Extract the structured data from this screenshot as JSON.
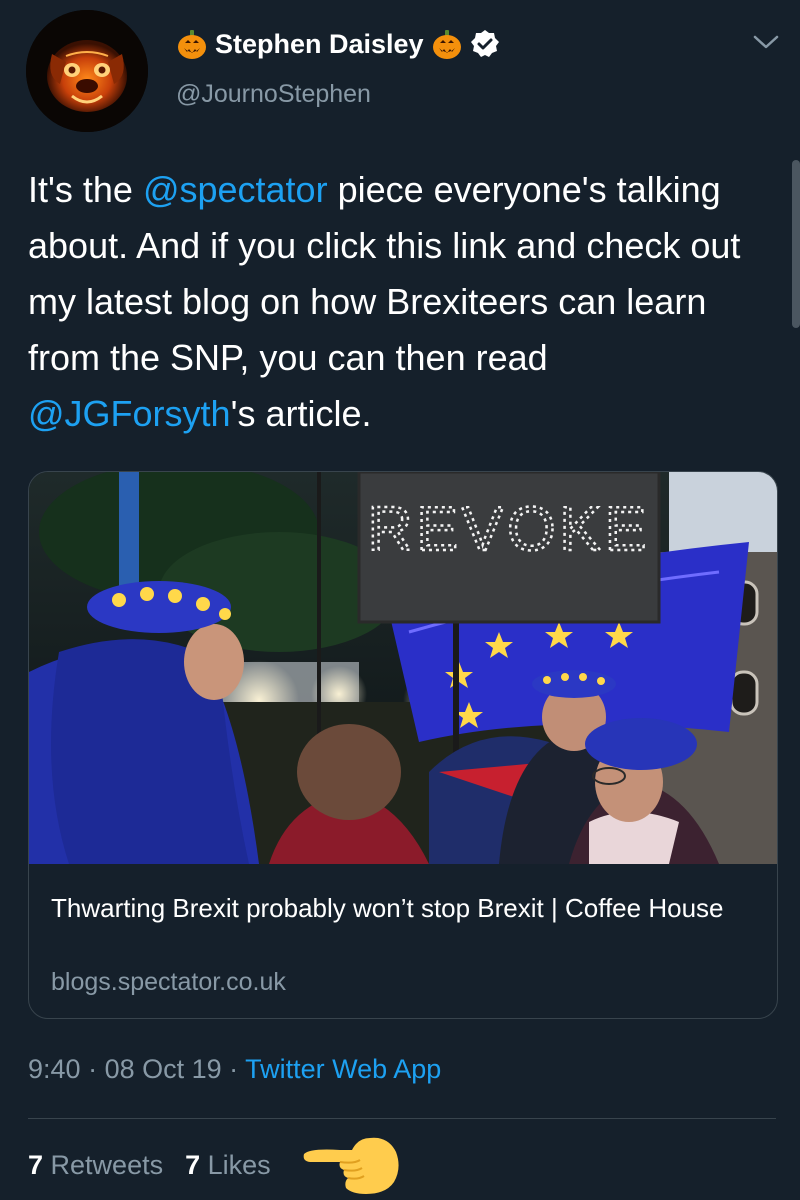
{
  "author": {
    "display_name": "Stephen Daisley",
    "handle": "@JournoStephen",
    "avatar_icon": "pug-jack-o-lantern-avatar",
    "name_emoji": "jack-o-lantern-emoji",
    "verified_icon": "verified-badge-icon"
  },
  "tweet": {
    "t1": "It's the ",
    "mention1": "@spectator",
    "t2": " piece everyone's talking about. And if you click this link and check out my latest blog on how Brexiteers can learn from the SNP, you can then read ",
    "mention2": "@JGForsyth",
    "t3": "'s article."
  },
  "card": {
    "title": "Thwarting Brexit probably won’t stop Brexit | Coffee House",
    "domain": "blogs.spectator.co.uk",
    "sign_text": "REVOKE"
  },
  "meta": {
    "time": "9:40",
    "sep1": " · ",
    "date": "08 Oct 19",
    "sep2": " · ",
    "app": "Twitter Web App"
  },
  "stats": {
    "retweets_count": "7",
    "retweets_label": " Retweets",
    "likes_count": "7",
    "likes_label": " Likes"
  },
  "colors": {
    "background": "#15202b",
    "link": "#1da1f2",
    "secondary_text": "#8899a6",
    "border": "#38444d",
    "pointer_emoji": "#ffcc4d"
  },
  "icons": {
    "more": "chevron-down-icon",
    "pointer": "backhand-index-pointing-left-emoji"
  }
}
